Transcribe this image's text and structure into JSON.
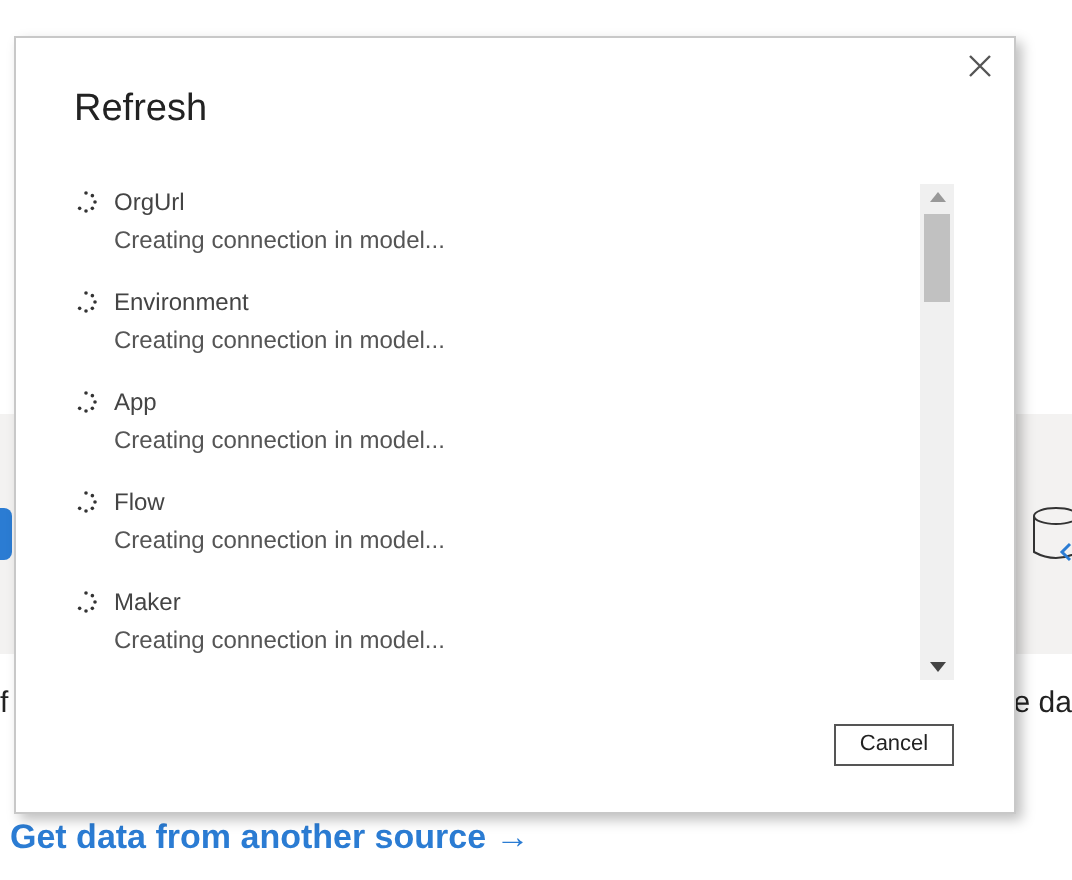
{
  "background": {
    "card_captions": [
      "f",
      "e da"
    ],
    "link": "Get data from another source →"
  },
  "dialog": {
    "title": "Refresh",
    "items": [
      {
        "name": "OrgUrl",
        "status": "Creating connection in model..."
      },
      {
        "name": "Environment",
        "status": "Creating connection in model..."
      },
      {
        "name": "App",
        "status": "Creating connection in model..."
      },
      {
        "name": "Flow",
        "status": "Creating connection in model..."
      },
      {
        "name": "Maker",
        "status": "Creating connection in model..."
      }
    ],
    "buttons": [
      "Cancel"
    ]
  }
}
